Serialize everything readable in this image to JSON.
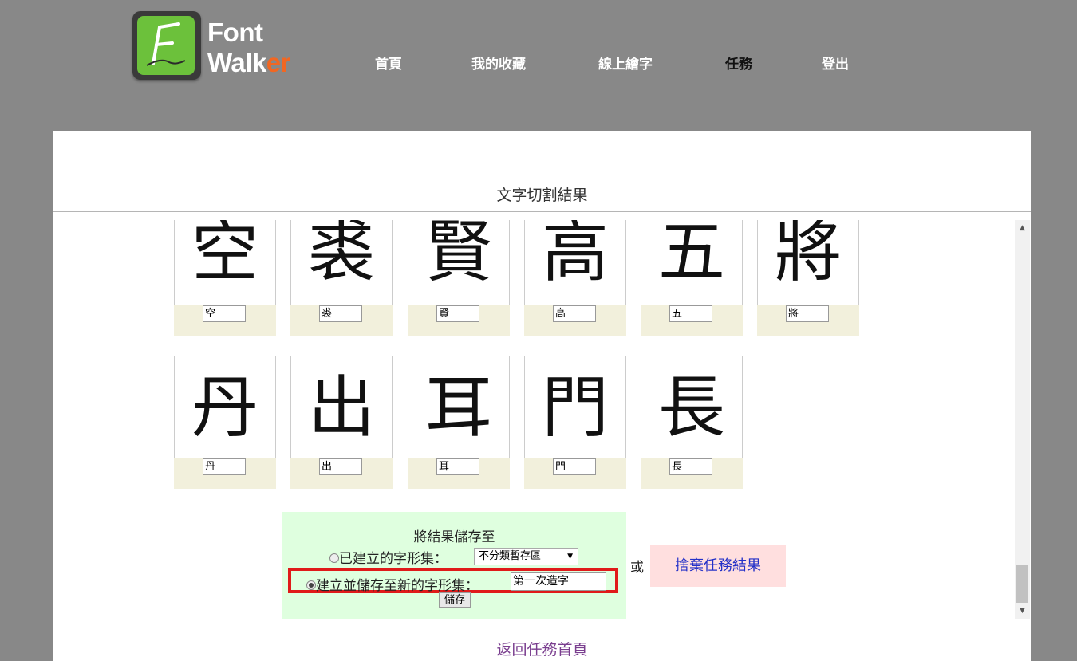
{
  "brand": {
    "name_line1": "Font",
    "name_line2_a": "Walk",
    "name_line2_b": "er",
    "accent": "#f26722",
    "logo_green": "#6cc13b"
  },
  "nav": [
    {
      "label": "首頁",
      "active": false
    },
    {
      "label": "我的收藏",
      "active": false
    },
    {
      "label": "線上繪字",
      "active": false
    },
    {
      "label": "任務",
      "active": true
    },
    {
      "label": "登出",
      "active": false
    }
  ],
  "page": {
    "section_title": "文字切割結果",
    "back_link": "返回任務首頁"
  },
  "glyphs_row1": [
    {
      "char": "空",
      "label": "空"
    },
    {
      "char": "裘",
      "label": "裘"
    },
    {
      "char": "賢",
      "label": "賢"
    },
    {
      "char": "高",
      "label": "高"
    },
    {
      "char": "五",
      "label": "五"
    },
    {
      "char": "將",
      "label": "將"
    }
  ],
  "glyphs_row2": [
    {
      "char": "丹",
      "label": "丹"
    },
    {
      "char": "出",
      "label": "出"
    },
    {
      "char": "耳",
      "label": "耳"
    },
    {
      "char": "門",
      "label": "門"
    },
    {
      "char": "長",
      "label": "長"
    }
  ],
  "save": {
    "title": "將結果儲存至",
    "existing_label": "已建立的字形集：",
    "existing_selected": "不分類暫存區",
    "new_label": "建立並儲存至新的字形集：",
    "new_name_value": "第一次造字",
    "save_button": "儲存",
    "selected_option": "new"
  },
  "or_text": "或",
  "discard_button": "捨棄任務結果",
  "colors": {
    "background": "#888888",
    "save_box": "#dfffdf",
    "discard_box": "#ffdfdf",
    "highlight_border": "#e01a1a",
    "label_band": "#f2f0dc"
  }
}
